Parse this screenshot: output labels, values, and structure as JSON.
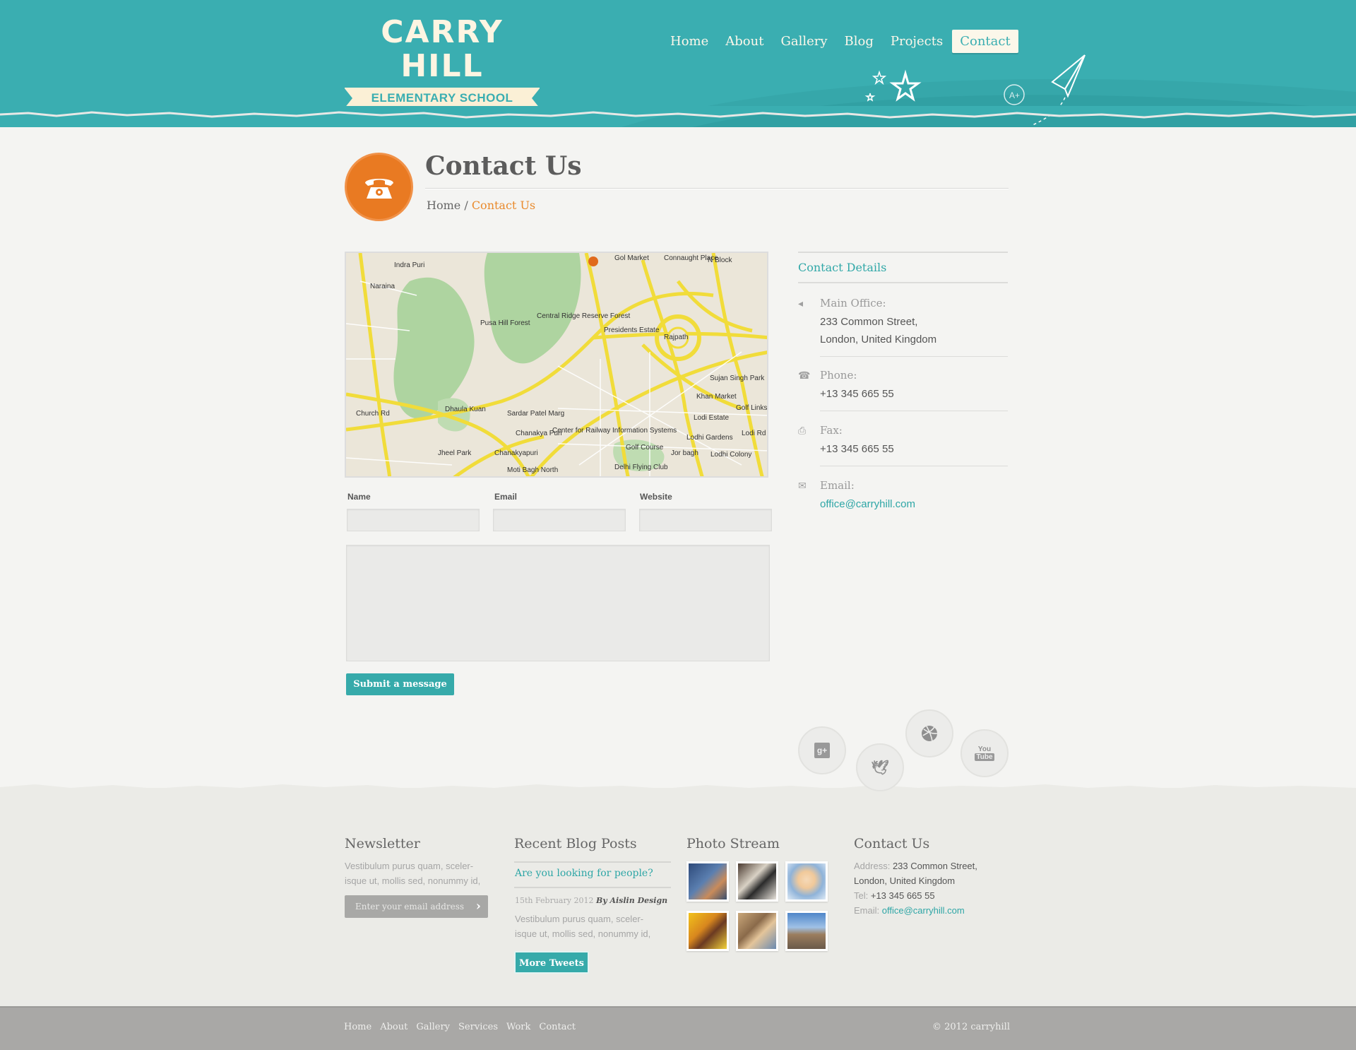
{
  "brand": {
    "title": "CARRY HILL",
    "subtitle": "ELEMENTARY SCHOOL"
  },
  "nav": {
    "items": [
      "Home",
      "About",
      "Gallery",
      "Blog",
      "Projects",
      "Contact"
    ],
    "active": "Contact"
  },
  "page": {
    "title": "Contact Us",
    "breadcrumb": {
      "home": "Home",
      "separator": "/",
      "current": "Contact Us"
    }
  },
  "map": {
    "labels": [
      "Gol Market",
      "Indra Puri",
      "Connaught Place",
      "N Block",
      "Naraina",
      "Pusa Hill Forest",
      "Central Ridge Reserve Forest",
      "Presidents Estate",
      "Rajpath",
      "Sujan Singh Park",
      "Khan Market",
      "Dhaula Kuan",
      "Sardar Patel Marg",
      "Chanakya Puri",
      "Center for Railway Information Systems",
      "Lodi Estate",
      "Golf Links",
      "Jor bagh",
      "Lodhi Gardens",
      "Lodhi Colony",
      "Jheel Park",
      "Chanakyapuri",
      "Moti Bagh North",
      "Delhi Flying Club",
      "Golf Course",
      "Church Rd",
      "Lodi Rd"
    ]
  },
  "form": {
    "name_label": "Name",
    "email_label": "Email",
    "website_label": "Website",
    "submit_label": "Submit a message"
  },
  "contact_details": {
    "title": "Contact Details",
    "main_office_label": "Main Office:",
    "main_office_line1": "233 Common Street,",
    "main_office_line2": "London, United Kingdom",
    "phone_label": "Phone:",
    "phone": "+13 345 665 55",
    "fax_label": "Fax:",
    "fax": "+13 345 665 55",
    "email_label": "Email:",
    "email": "office@carryhill.com"
  },
  "social": {
    "icons": [
      "google-plus-icon",
      "twitter-icon",
      "dribbble-icon",
      "youtube-icon"
    ],
    "google_plus": "g+",
    "youtube_top": "You",
    "youtube_bottom": "Tube"
  },
  "footer": {
    "newsletter": {
      "heading": "Newsletter",
      "text_line1": "Vestibulum purus quam, sceler-",
      "text_line2": "isque ut, mollis sed, nonummy id,",
      "placeholder": "Enter your email address"
    },
    "blog": {
      "heading": "Recent Blog Posts",
      "post_title": "Are you looking for people?",
      "date": "15th February 2012",
      "author": "By Aislin Design",
      "text_line1": "Vestibulum purus quam, sceler-",
      "text_line2": "isque ut, mollis sed, nonummy id,",
      "button": "More Tweets"
    },
    "photos": {
      "heading": "Photo Stream"
    },
    "contact": {
      "heading": "Contact Us",
      "address_label": "Address:",
      "address_line1": "233 Common Street,",
      "address_line2": "London, United Kingdom",
      "tel_label": "Tel:",
      "tel": "+13 345 665 55",
      "email_label": "Email:",
      "email": "office@carryhill.com"
    }
  },
  "bottom_bar": {
    "links": [
      "Home",
      "About",
      "Gallery",
      "Services",
      "Work",
      "Contact"
    ],
    "copyright": "© 2012 carryhill"
  },
  "colors": {
    "teal": "#3aaeb1",
    "orange": "#e97a22",
    "link": "#2ea6a6"
  }
}
